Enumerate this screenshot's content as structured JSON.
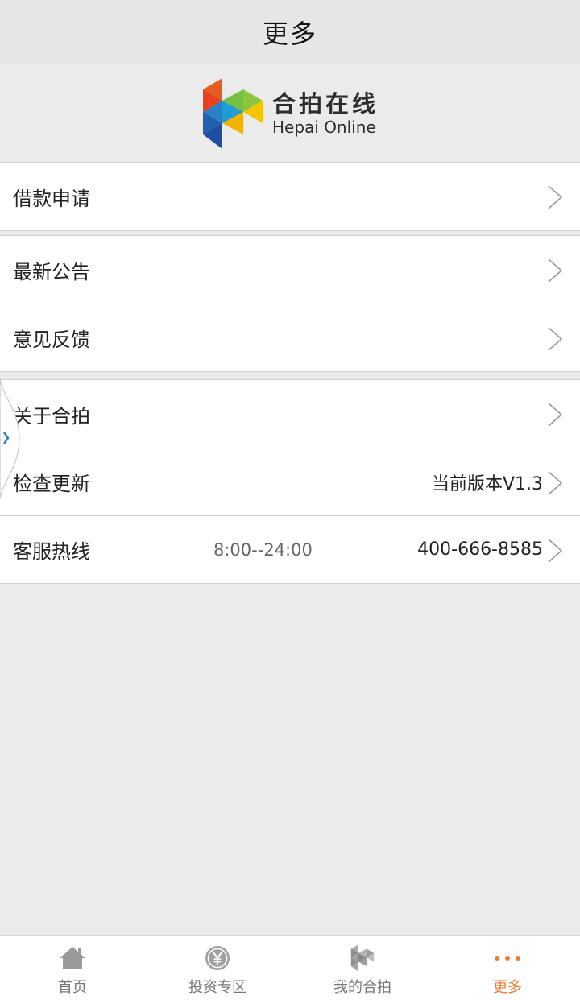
{
  "header": {
    "title": "更多"
  },
  "brand": {
    "name_cn": "合拍在线",
    "name_en": "Hepai Online"
  },
  "menu": {
    "loan_apply": "借款申请",
    "notice": "最新公告",
    "feedback": "意见反馈",
    "about": "关于合拍",
    "check_update": "检查更新",
    "current_version": "当前版本V1.3",
    "hotline": "客服热线",
    "hotline_hours": "8:00--24:00",
    "hotline_number": "400-666-8585"
  },
  "tabs": {
    "home": "首页",
    "invest": "投资专区",
    "mine": "我的合拍",
    "more": "更多"
  },
  "colors": {
    "accent": "#f07a33",
    "background": "#ebebeb"
  }
}
